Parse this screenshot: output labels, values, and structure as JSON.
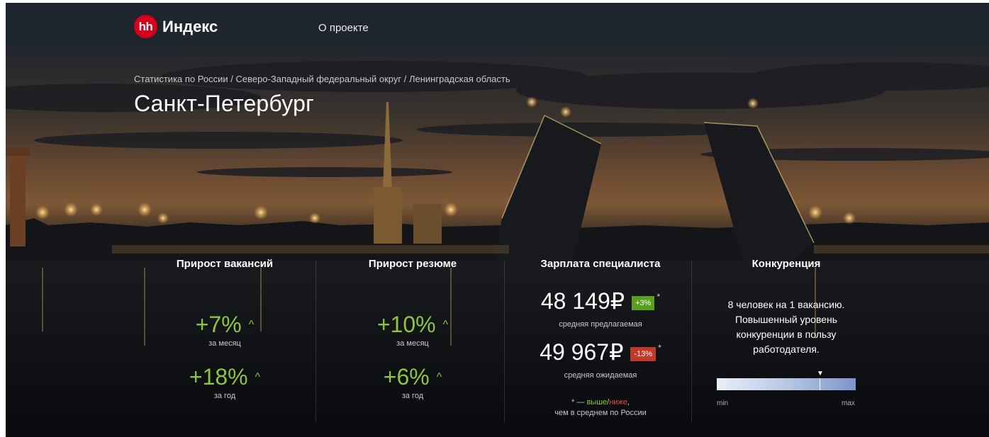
{
  "header": {
    "logo_badge": "hh",
    "logo_text": "Индекс",
    "nav_about": "О проекте"
  },
  "breadcrumb": [
    "Статистика по России",
    "Северо-Западный федеральный округ",
    "Ленинградская область"
  ],
  "breadcrumb_separator": " / ",
  "city": "Санкт-Петербург",
  "stats": {
    "vacancies": {
      "title": "Прирост вакансий",
      "month_value": "+7%",
      "month_label": "за месяц",
      "year_value": "+18%",
      "year_label": "за год"
    },
    "resumes": {
      "title": "Прирост резюме",
      "month_value": "+10%",
      "month_label": "за месяц",
      "year_value": "+6%",
      "year_label": "за год"
    },
    "salary": {
      "title": "Зарплата специалиста",
      "offered_value": "48 149₽",
      "offered_badge": "+3%",
      "offered_label": "средняя предлагаемая",
      "expected_value": "49 967₽",
      "expected_badge": "-13%",
      "expected_label": "средняя ожидаемая",
      "star": "*",
      "note_prefix": "* — ",
      "note_higher": "выше",
      "note_slash": "/",
      "note_lower": "ниже",
      "note_comma": ",",
      "note_line2": "чем в среднем по России"
    },
    "competition": {
      "title": "Конкуренция",
      "text_line1": "8 человек на 1 вакансию.",
      "text_line2": "Повышенный уровень",
      "text_line3": "конкуренции в пользу",
      "text_line4": "работодателя.",
      "scale_min": "min",
      "scale_max": "max",
      "level": 0.74
    }
  },
  "icons": {
    "caret_up": "^",
    "marker": "▼"
  },
  "colors": {
    "header_bg": "#1f252e",
    "logo_red": "#d6001c",
    "growth_green": "#8cc63f",
    "badge_up": "#5a9f1d",
    "badge_down": "#c0392b"
  }
}
